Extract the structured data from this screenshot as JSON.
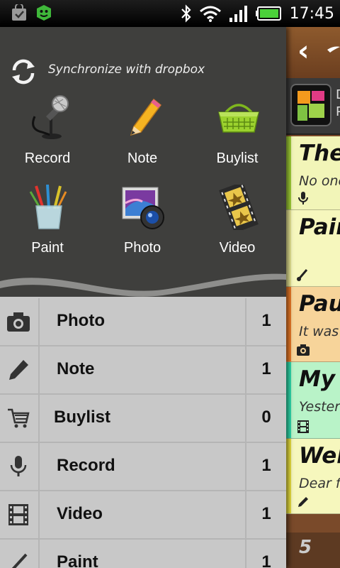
{
  "status_bar": {
    "time": "17:45",
    "left_icons": [
      "bag-icon",
      "android-app-icon"
    ],
    "right_icons": [
      "bluetooth-icon",
      "wifi-icon",
      "signal-icon",
      "battery-icon"
    ]
  },
  "drawer": {
    "sync_label": "Synchronize with dropbox",
    "quick_actions": [
      {
        "label": "Record",
        "icon": "microphone-icon"
      },
      {
        "label": "Note",
        "icon": "pencil-icon"
      },
      {
        "label": "Buylist",
        "icon": "shopping-basket-icon"
      },
      {
        "label": "Paint",
        "icon": "brushes-cup-icon"
      },
      {
        "label": "Photo",
        "icon": "photo-camera-icon"
      },
      {
        "label": "Video",
        "icon": "film-reel-icon"
      }
    ],
    "categories": [
      {
        "label": "Photo",
        "count": "1",
        "icon": "camera-icon"
      },
      {
        "label": "Note",
        "count": "1",
        "icon": "pencil-icon"
      },
      {
        "label": "Buylist",
        "count": "0",
        "icon": "cart-icon"
      },
      {
        "label": "Record",
        "count": "1",
        "icon": "microphone-icon"
      },
      {
        "label": "Video",
        "count": "1",
        "icon": "film-icon"
      },
      {
        "label": "Paint",
        "count": "1",
        "icon": "brush-icon"
      }
    ]
  },
  "notes": {
    "banner_text": "D\nP",
    "cards": [
      {
        "title": "The",
        "subtitle": "No one",
        "color": "#f2f5b8",
        "strip": "#a6d639",
        "icon": "microphone-icon"
      },
      {
        "title": "Pain",
        "subtitle": "",
        "color": "#f6f7bd",
        "strip": "#f0ef9a",
        "icon": "brush-icon"
      },
      {
        "title": "Pau",
        "subtitle": "It was",
        "color": "#f7d49a",
        "strip": "#f07d28",
        "icon": "camera-icon"
      },
      {
        "title": "My",
        "subtitle": "Yester",
        "color": "#b9f3c8",
        "strip": "#2fe0b0",
        "icon": "film-icon"
      },
      {
        "title": "Wel",
        "subtitle": "Dear fi",
        "color": "#f6f7bd",
        "strip": "#f0e640",
        "icon": "pencil-icon"
      }
    ],
    "page_number": "5"
  }
}
